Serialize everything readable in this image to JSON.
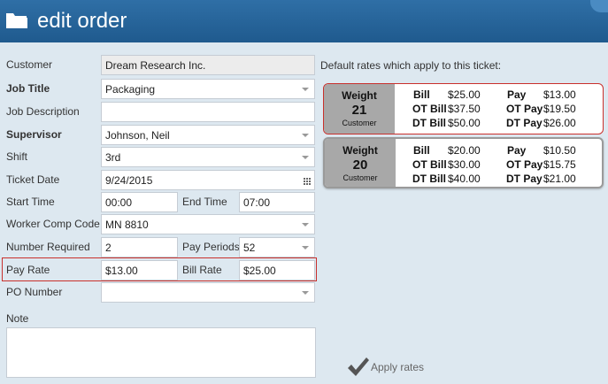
{
  "header": {
    "title": "edit order",
    "icon": "folder-icon"
  },
  "form": {
    "customer": {
      "label": "Customer",
      "value": "Dream Research Inc."
    },
    "job_title": {
      "label": "Job Title",
      "value": "Packaging"
    },
    "job_description": {
      "label": "Job Description",
      "value": ""
    },
    "supervisor": {
      "label": "Supervisor",
      "value": "Johnson, Neil"
    },
    "shift": {
      "label": "Shift",
      "value": "3rd"
    },
    "ticket_date": {
      "label": "Ticket Date",
      "value": "9/24/2015"
    },
    "start_time": {
      "label": "Start Time",
      "value": "00:00"
    },
    "end_time": {
      "label": "End Time",
      "value": "07:00"
    },
    "worker_comp_code": {
      "label": "Worker Comp Code",
      "value": "MN 8810"
    },
    "number_required": {
      "label": "Number Required",
      "value": "2"
    },
    "pay_periods": {
      "label": "Pay Periods",
      "value": "52"
    },
    "pay_rate": {
      "label": "Pay Rate",
      "value": "$13.00"
    },
    "bill_rate": {
      "label": "Bill Rate",
      "value": "$25.00"
    },
    "po_number": {
      "label": "PO Number",
      "value": ""
    },
    "note": {
      "label": "Note",
      "value": ""
    }
  },
  "rates": {
    "title": "Default rates which apply to this ticket:",
    "cards": [
      {
        "heading": "Weight",
        "number": "21",
        "source": "Customer",
        "selected": true,
        "bill_label": "Bill",
        "bill": "$25.00",
        "pay_label": "Pay",
        "pay": "$13.00",
        "ot_bill_label": "OT Bill",
        "ot_bill": "$37.50",
        "ot_pay_label": "OT Pay",
        "ot_pay": "$19.50",
        "dt_bill_label": "DT Bill",
        "dt_bill": "$50.00",
        "dt_pay_label": "DT Pay",
        "dt_pay": "$26.00"
      },
      {
        "heading": "Weight",
        "number": "20",
        "source": "Customer",
        "selected": false,
        "bill_label": "Bill",
        "bill": "$20.00",
        "pay_label": "Pay",
        "pay": "$10.50",
        "ot_bill_label": "OT Bill",
        "ot_bill": "$30.00",
        "ot_pay_label": "OT Pay",
        "ot_pay": "$15.75",
        "dt_bill_label": "DT Bill",
        "dt_bill": "$40.00",
        "dt_pay_label": "DT Pay",
        "dt_pay": "$21.00"
      }
    ]
  },
  "apply": {
    "label": "Apply rates",
    "icon": "checkmark-icon"
  },
  "colors": {
    "header": "#2a679c",
    "highlight": "#c9302c",
    "background": "#dde8f0"
  }
}
